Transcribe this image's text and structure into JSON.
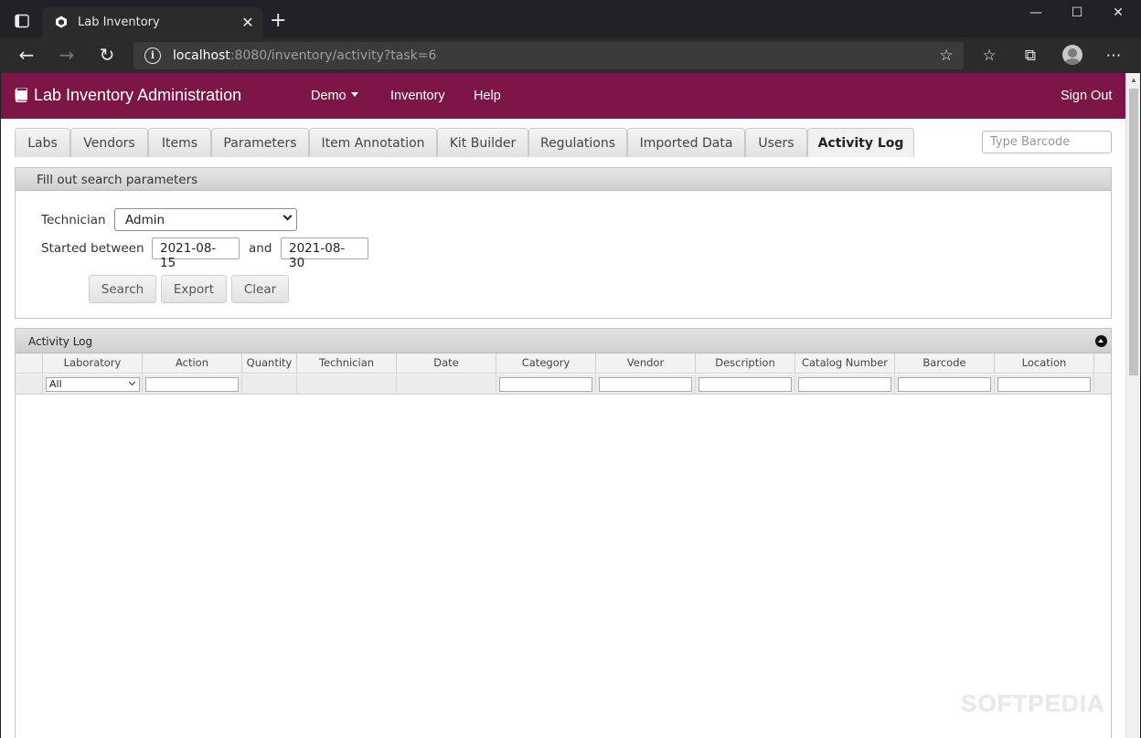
{
  "browser": {
    "tab_title": "Lab Inventory",
    "url_host": "localhost",
    "url_rest": ":8080/inventory/activity?task=6"
  },
  "header": {
    "brand": "Lab Inventory Administration",
    "nav": [
      "Demo",
      "Inventory",
      "Help"
    ],
    "sign_out": "Sign Out"
  },
  "tabs": [
    "Labs",
    "Vendors",
    "Items",
    "Parameters",
    "Item Annotation",
    "Kit Builder",
    "Regulations",
    "Imported Data",
    "Users",
    "Activity Log"
  ],
  "active_tab": "Activity Log",
  "barcode": {
    "placeholder": "Type Barcode"
  },
  "search": {
    "title": "Fill out search parameters",
    "technician_label": "Technician",
    "technician_value": "Admin",
    "started_label": "Started between",
    "date_from": "2021-08-15",
    "and_label": "and",
    "date_to": "2021-08-30",
    "buttons": {
      "search": "Search",
      "export": "Export",
      "clear": "Clear"
    }
  },
  "grid": {
    "title": "Activity Log",
    "columns": [
      "Laboratory",
      "Action",
      "Quantity",
      "Technician",
      "Date",
      "Category",
      "Vendor",
      "Description",
      "Catalog Number",
      "Barcode",
      "Location"
    ],
    "laboratory_filter": "All",
    "rows": []
  },
  "watermark": "SOFTPEDIA",
  "colors": {
    "header": "#7b1646"
  }
}
